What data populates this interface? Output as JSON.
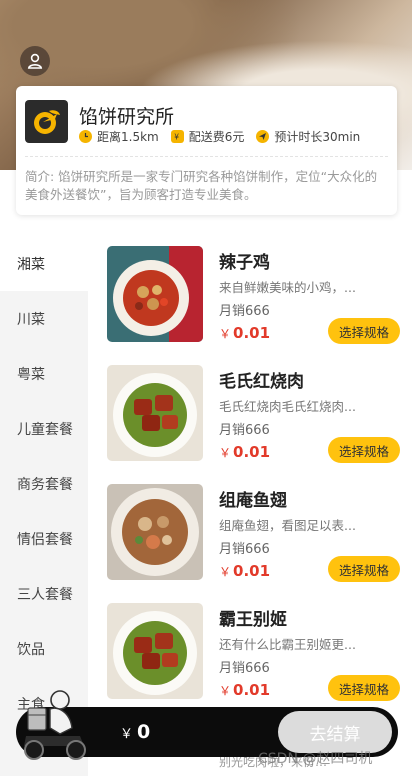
{
  "store": {
    "name": "馅饼研究所",
    "distance": "距离1.5km",
    "delivery_fee": "配送费6元",
    "eta": "预计时长30min",
    "description": "简介: 馅饼研究所是一家专门研究各种馅饼制作，定位“大众化的美食外送餐饮”，旨为顾客打造专业美食。"
  },
  "sidebar": {
    "items": [
      {
        "label": "湘菜"
      },
      {
        "label": "川菜"
      },
      {
        "label": "粤菜"
      },
      {
        "label": "儿童套餐"
      },
      {
        "label": "商务套餐"
      },
      {
        "label": "情侣套餐"
      },
      {
        "label": "三人套餐"
      },
      {
        "label": "饮品"
      },
      {
        "label": "主食"
      }
    ]
  },
  "dishes": [
    {
      "name": "辣子鸡",
      "desc": "来自鲜嫩美味的小鸡，...",
      "sales": "月销666",
      "currency": "￥",
      "price": "0.01",
      "action": "选择规格"
    },
    {
      "name": "毛氏红烧肉",
      "desc": "毛氏红烧肉毛氏红烧肉...",
      "sales": "月销666",
      "currency": "￥",
      "price": "0.01",
      "action": "选择规格"
    },
    {
      "name": "组庵鱼翅",
      "desc": "组庵鱼翅，看图足以表...",
      "sales": "月销666",
      "currency": "￥",
      "price": "0.01",
      "action": "选择规格"
    },
    {
      "name": "霸王别姬",
      "desc": "还有什么比霸王别姬更...",
      "sales": "月销666",
      "currency": "￥",
      "price": "0.01",
      "action": "选择规格"
    }
  ],
  "next_dish_peek": "别光吃肉啦，来份…",
  "cart": {
    "currency": "￥",
    "total": "0",
    "checkout": "去结算"
  },
  "watermark": "CSDN @赵四司机",
  "colors": {
    "accent": "#ffc20e",
    "price": "#e23a2a",
    "cart": "#0c0c0c"
  }
}
